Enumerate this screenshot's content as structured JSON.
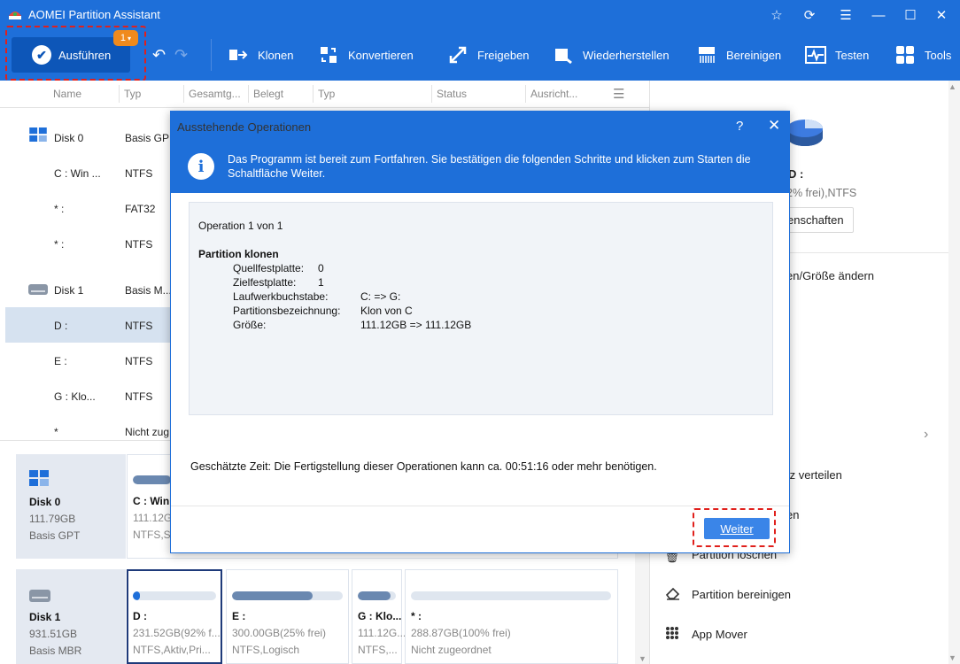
{
  "window": {
    "title": "AOMEI Partition Assistant"
  },
  "toolbar": {
    "run_label": "Ausführen",
    "pending_count": "1",
    "items": [
      {
        "label": "Klonen",
        "icon": "clone-icon"
      },
      {
        "label": "Konvertieren",
        "icon": "convert-icon"
      },
      {
        "label": "Freigeben",
        "icon": "free-up-icon"
      },
      {
        "label": "Wiederherstellen",
        "icon": "recover-icon"
      },
      {
        "label": "Bereinigen",
        "icon": "wipe-icon"
      },
      {
        "label": "Testen",
        "icon": "test-icon"
      },
      {
        "label": "Tools",
        "icon": "tools-icon"
      }
    ]
  },
  "columns": [
    "Name",
    "Typ",
    "Gesamtg...",
    "Belegt",
    "Typ",
    "Status",
    "Ausricht..."
  ],
  "rows": [
    {
      "name": "Disk 0",
      "type": "Basis GP",
      "is_disk": true
    },
    {
      "name": "C : Win ...",
      "type": "NTFS"
    },
    {
      "name": "* :",
      "type": "FAT32"
    },
    {
      "name": "* :",
      "type": "NTFS"
    },
    {
      "name": "Disk 1",
      "type": "Basis M...",
      "is_disk": true
    },
    {
      "name": "D :",
      "type": "NTFS",
      "selected": true
    },
    {
      "name": "E :",
      "type": "NTFS"
    },
    {
      "name": "G : Klo...",
      "type": "NTFS"
    },
    {
      "name": "*",
      "type": "Nicht zug"
    }
  ],
  "right_panel": {
    "drive_label": "D :",
    "drive_info": "2% frei),NTFS",
    "properties_btn": "enschaften",
    "actions": [
      {
        "label": "en/Größe ändern"
      },
      {
        "label": "tz verteilen"
      },
      {
        "label": "en"
      },
      {
        "label": "Partition löschen"
      },
      {
        "label": "Partition bereinigen"
      },
      {
        "label": "App Mover"
      }
    ]
  },
  "disk_map": {
    "disk0": {
      "name": "Disk 0",
      "size": "111.79GB",
      "style": "Basis GPT",
      "partitions": [
        {
          "name": "C : Win",
          "size": "111.12G",
          "fs": "NTFS,S",
          "fill": 0.85
        }
      ]
    },
    "disk1": {
      "name": "Disk 1",
      "size": "931.51GB",
      "style": "Basis MBR",
      "partitions": [
        {
          "name": "D :",
          "size": "231.52GB(92% f...",
          "fs": "NTFS,Aktiv,Pri...",
          "fill": 0.08
        },
        {
          "name": "E :",
          "size": "300.00GB(25% frei)",
          "fs": "NTFS,Logisch",
          "fill": 0.73
        },
        {
          "name": "G : Klo...",
          "size": "111.12G...",
          "fs": "NTFS,...",
          "fill": 0.85
        },
        {
          "name": "* :",
          "size": "288.87GB(100% frei)",
          "fs": "Nicht zugeordnet",
          "fill": 0.0
        }
      ]
    }
  },
  "dialog": {
    "title": "Ausstehende Operationen",
    "help": "?",
    "close": "✕",
    "message": "Das Programm ist bereit zum Fortfahren. Sie bestätigen die folgenden Schritte und klicken zum Starten die Schaltfläche Weiter.",
    "op_counter": "Operation 1 von 1",
    "op_title": "Partition klonen",
    "details": [
      {
        "key": "Quellfestplatte:",
        "value": "0"
      },
      {
        "key": "Zielfestplatte:",
        "value": "1"
      },
      {
        "key": "Laufwerkbuchstabe:",
        "value": "C: => G:"
      },
      {
        "key": "Partitionsbezeichnung:",
        "value": "Klon von C"
      },
      {
        "key": "Größe:",
        "value": "111.12GB => 111.12GB"
      }
    ],
    "estimate": "Geschätzte Zeit: Die Fertigstellung dieser Operationen kann ca. 00:51:16 oder mehr benötigen.",
    "next_label": "Weiter"
  }
}
